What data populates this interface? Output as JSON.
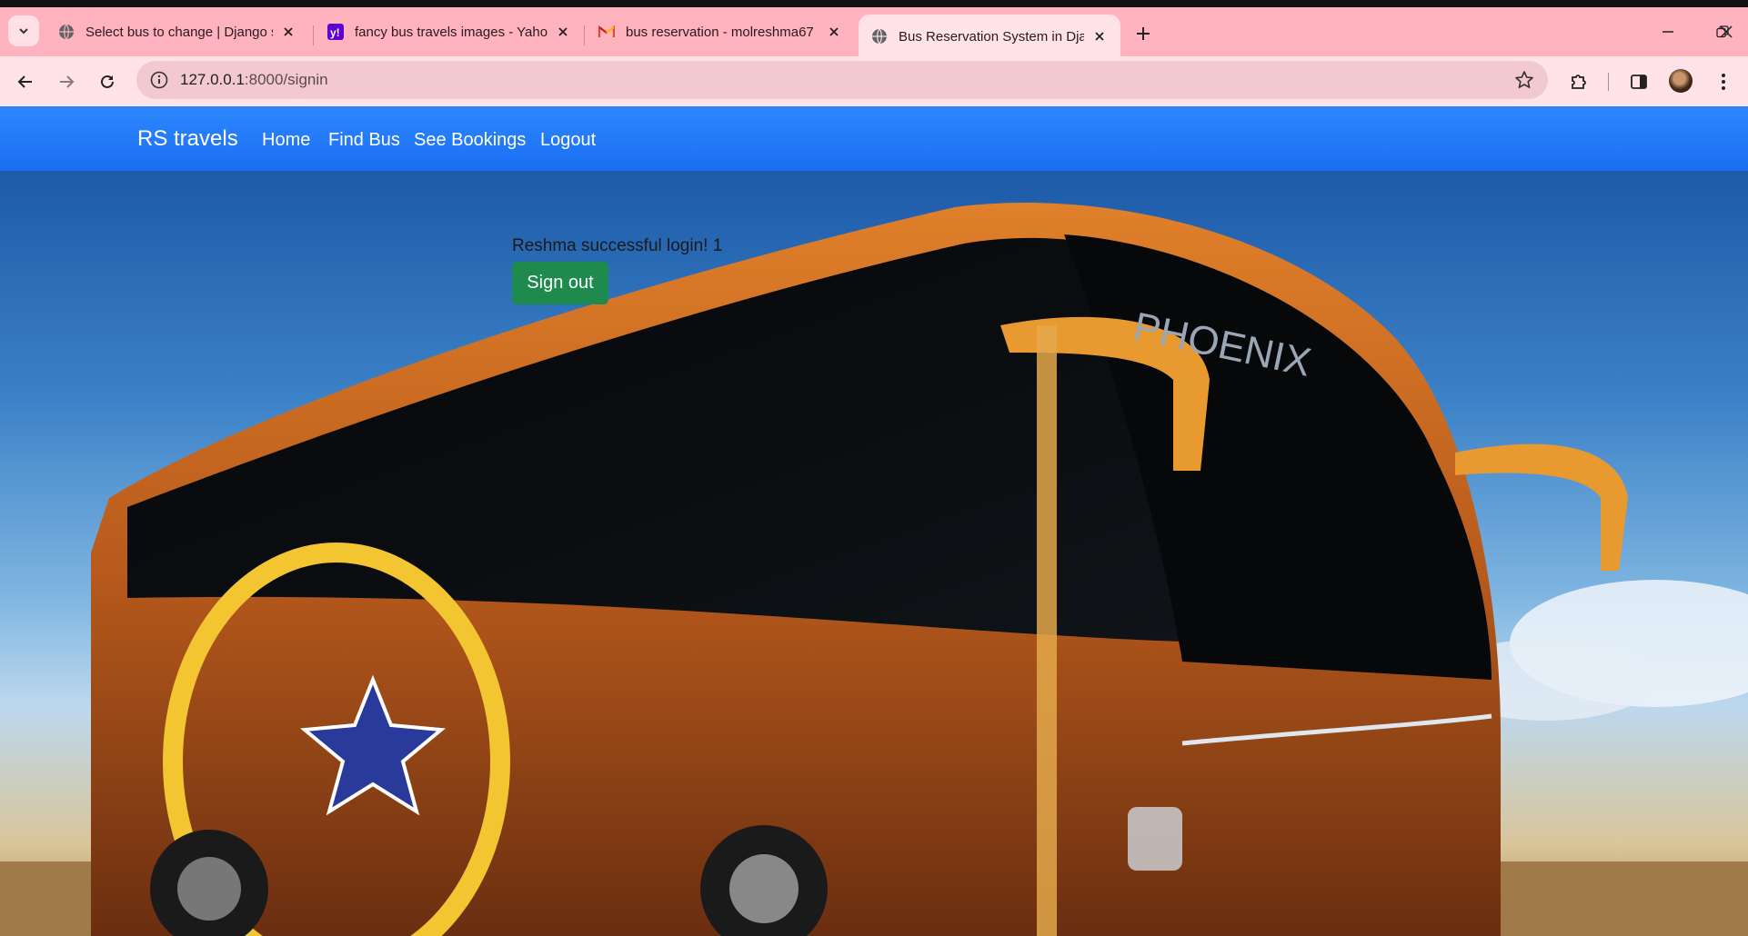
{
  "browser": {
    "tabs": [
      {
        "title": "Select bus to change | Django s",
        "icon": "globe-icon",
        "active": false
      },
      {
        "title": "fancy bus travels images - Yahoo",
        "icon": "yahoo-icon",
        "active": false
      },
      {
        "title": "bus reservation - molreshma67",
        "icon": "gmail-icon",
        "active": false
      },
      {
        "title": "Bus Reservation System in Djan",
        "icon": "globe-icon",
        "active": true
      }
    ],
    "url_host": "127.0.0.1",
    "url_rest": ":8000/signin",
    "accent": "#ffb3bf"
  },
  "site": {
    "brand": "RS travels",
    "nav": [
      "Home",
      "Find Bus",
      "See Bookings",
      "Logout"
    ],
    "navbar_color": "#1a6ff2"
  },
  "main": {
    "message": "Reshma successful login! 1",
    "signout_label": "Sign out",
    "signout_color": "#1e8a4e"
  }
}
